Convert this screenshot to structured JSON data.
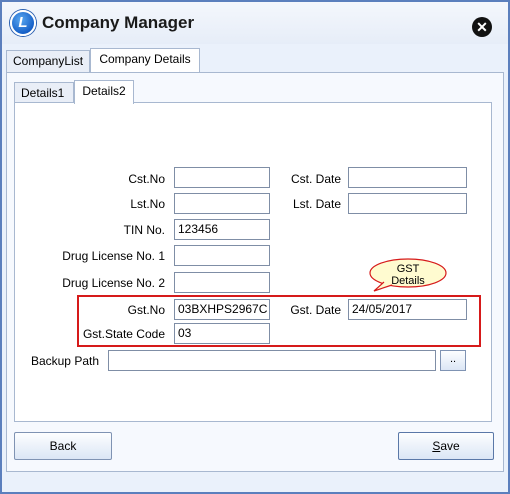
{
  "window": {
    "title": "Company Manager",
    "logo_letter": "L",
    "close_symbol": "✕"
  },
  "main_tabs": [
    {
      "label": "CompanyList",
      "active": false
    },
    {
      "label": "Company Details",
      "active": true
    }
  ],
  "sub_tabs": [
    {
      "label": "Details1",
      "active": false
    },
    {
      "label": "Details2",
      "active": true
    }
  ],
  "form": {
    "cst_no": {
      "label": "Cst.No",
      "value": ""
    },
    "cst_date": {
      "label": "Cst. Date",
      "value": ""
    },
    "lst_no": {
      "label": "Lst.No",
      "value": ""
    },
    "lst_date": {
      "label": "Lst. Date",
      "value": ""
    },
    "tin_no": {
      "label": "TIN No.",
      "value": "123456"
    },
    "drug_license_1": {
      "label": "Drug License No. 1",
      "value": ""
    },
    "drug_license_2": {
      "label": "Drug License No. 2",
      "value": ""
    },
    "gst_no": {
      "label": "Gst.No",
      "value": "03BXHPS2967C"
    },
    "gst_date": {
      "label": "Gst. Date",
      "value": "24/05/2017"
    },
    "gst_state_code": {
      "label": "Gst.State Code",
      "value": "03"
    },
    "backup_path": {
      "label": "Backup Path",
      "value": "",
      "browse_label": ".."
    }
  },
  "callout": {
    "line1": "GST",
    "line2": "Details"
  },
  "buttons": {
    "back": "Back",
    "save": "Save"
  },
  "colors": {
    "highlight_box": "#d61a1a",
    "callout_fill": "#fffbd0",
    "title_bar": "#e6edf8",
    "window_border": "#5b7fbd"
  }
}
